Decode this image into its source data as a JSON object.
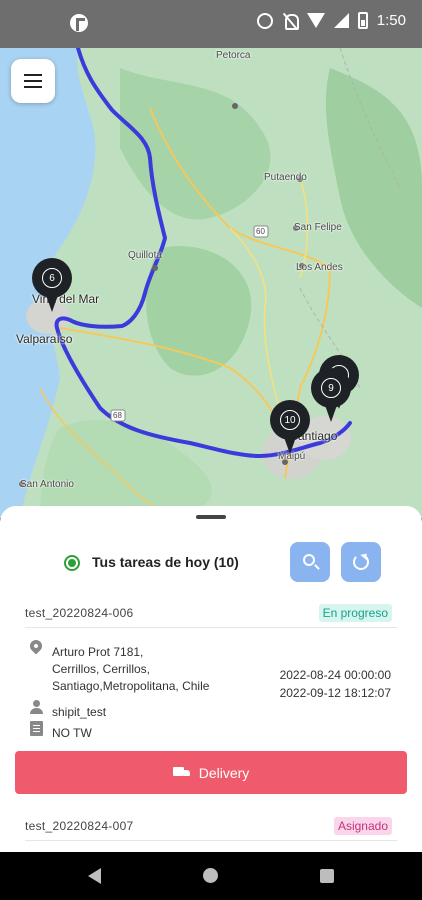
{
  "status_bar": {
    "time": "1:50",
    "icons": [
      "notification-app-icon",
      "alarm-icon",
      "mute-icon",
      "wifi-icon",
      "signal-icon",
      "battery-icon"
    ]
  },
  "map": {
    "labels": {
      "petorca": "Petorca",
      "putaendo": "Putaendo",
      "san_felipe": "San Felipe",
      "los_andes": "Los Andes",
      "quillota": "Quillota",
      "vina": "Viña del Mar",
      "valparaiso": "Valparaíso",
      "santiago": "Santiago",
      "maipu": "Maipú",
      "san_antonio": "San Antonio",
      "route_60": "60",
      "route_68": "68"
    },
    "markers": [
      "6",
      "10",
      "9",
      "7"
    ],
    "route_color": "#3b3bdc"
  },
  "sheet": {
    "title": "Tus tareas de hoy (10)",
    "tasks": [
      {
        "id": "test_20220824-006",
        "status": "En progreso",
        "address_line1": "Arturo Prot 7181,",
        "address_line2": "Cerrillos, Cerrillos,",
        "address_line3": "Santiago,Metropolitana, Chile",
        "date_start": "2022-08-24 00:00:00",
        "date_end": "2022-09-12 18:12:07",
        "user": "shipit_test",
        "tw": "NO TW",
        "action": "Delivery"
      },
      {
        "id": "test_20220824-007",
        "status": "Asignado"
      }
    ]
  },
  "colors": {
    "accent_blue": "#8ab4f0",
    "delivery_red": "#ef5b6c",
    "in_progress": "#18a18a",
    "assigned": "#c2337d"
  }
}
